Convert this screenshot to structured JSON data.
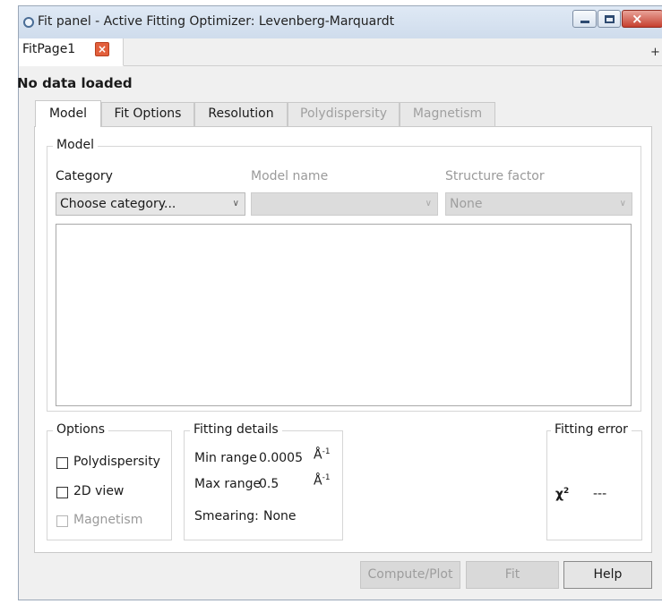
{
  "window": {
    "title": "Fit panel - Active Fitting Optimizer: Levenberg-Marquardt",
    "min_glyph": "",
    "max_glyph": "",
    "close_glyph": "×"
  },
  "page_tabs": {
    "active_label": "FitPage1",
    "close_glyph": "×",
    "add_glyph": "+"
  },
  "status": {
    "data_label": "No data loaded"
  },
  "tabs": [
    {
      "label": "Model",
      "enabled": true,
      "active": true
    },
    {
      "label": "Fit Options",
      "enabled": true,
      "active": false
    },
    {
      "label": "Resolution",
      "enabled": true,
      "active": false
    },
    {
      "label": "Polydispersity",
      "enabled": false,
      "active": false
    },
    {
      "label": "Magnetism",
      "enabled": false,
      "active": false
    }
  ],
  "model_group": {
    "title": "Model",
    "category_label": "Category",
    "model_name_label": "Model name",
    "structure_factor_label": "Structure factor",
    "category_value": "Choose category...",
    "model_name_value": "",
    "structure_factor_value": "None",
    "arrow": "∨"
  },
  "options_group": {
    "title": "Options",
    "polydispersity_label": "Polydispersity",
    "view2d_label": "2D view",
    "magnetism_label": "Magnetism",
    "polydispersity_checked": false,
    "view2d_checked": false,
    "magnetism_enabled": false
  },
  "fitting_details": {
    "title": "Fitting details",
    "min_range_label": "Min range",
    "min_range_value": "0.0005",
    "max_range_label": "Max range",
    "max_range_value": "0.5",
    "unit": "Å",
    "unit_exp": "-1",
    "smearing_label": "Smearing:",
    "smearing_value": "None"
  },
  "fitting_error": {
    "title": "Fitting error",
    "chi_symbol": "χ",
    "chi_exp": "2",
    "chi_value": "---"
  },
  "buttons": {
    "compute_plot": "Compute/Plot",
    "fit": "Fit",
    "help": "Help"
  },
  "colors": {
    "window_bg": "#f0f0f0",
    "titlebar": "#dfe9f5",
    "close_button": "#c6402f",
    "page_close": "#e25f3c"
  }
}
